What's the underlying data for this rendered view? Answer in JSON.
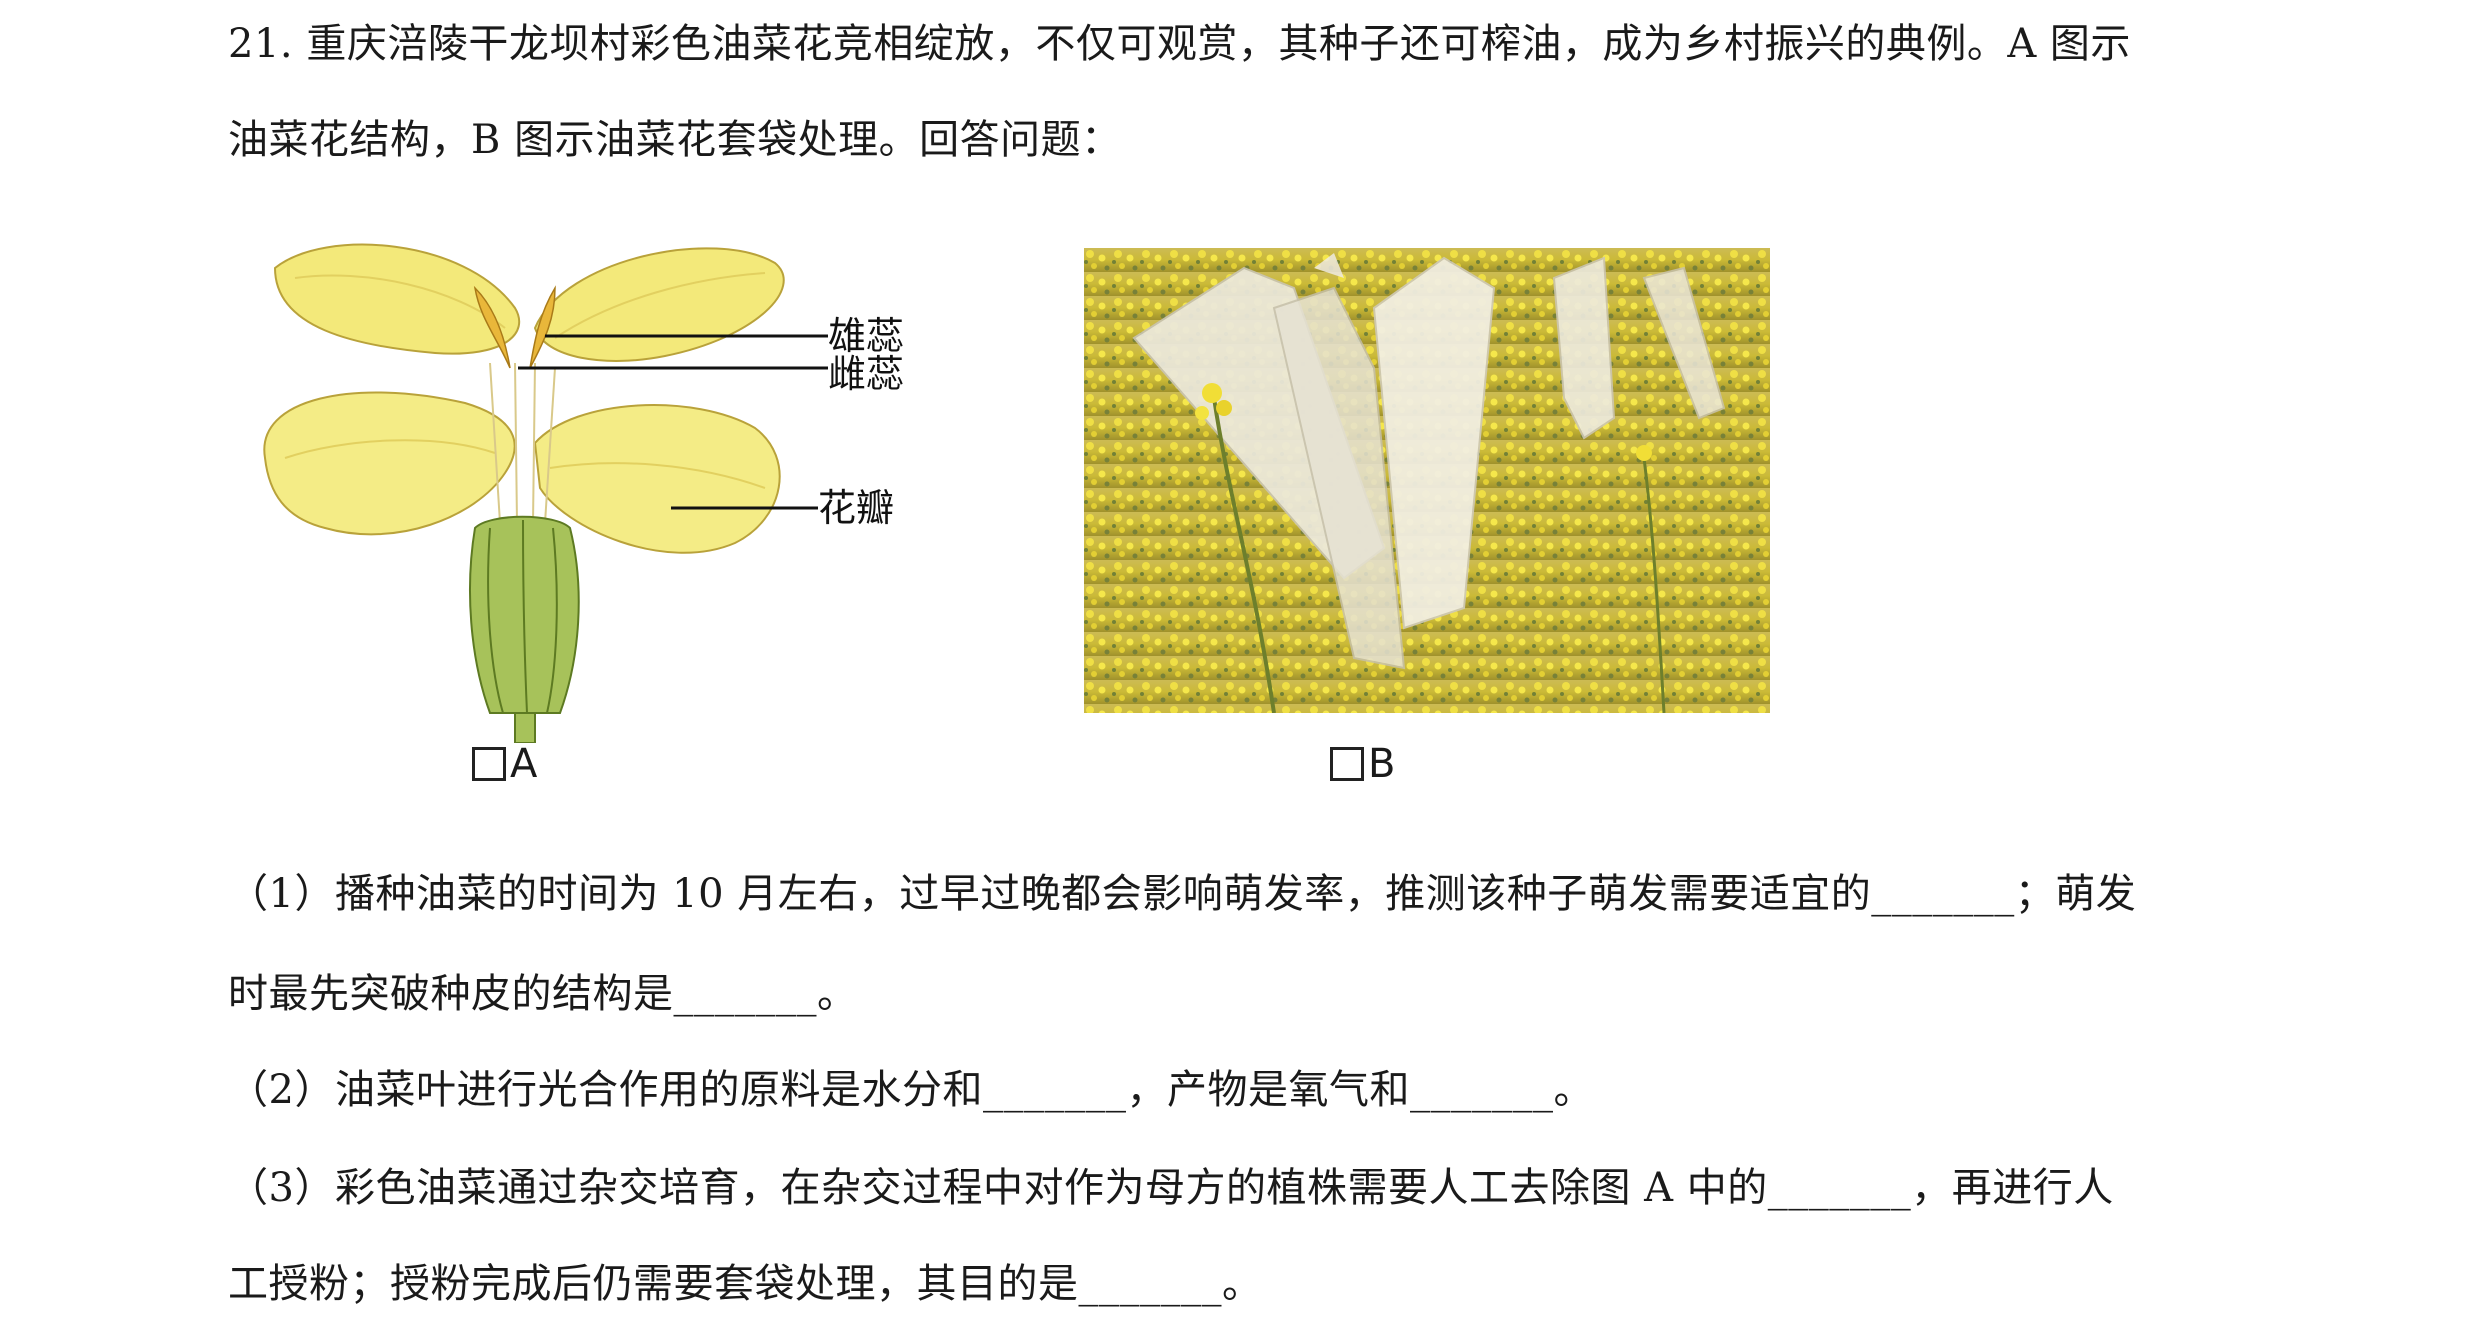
{
  "question": {
    "stem_line1": "21. 重庆涪陵干龙坝村彩色油菜花竞相绽放，不仅可观赏，其种子还可榨油，成为乡村振兴的典例。A 图示",
    "stem_line2": "油菜花结构，B 图示油菜花套袋处理。回答问题："
  },
  "figure_a": {
    "caption": "A",
    "labels": {
      "stamen": "雄蕊",
      "pistil": "雌蕊",
      "petal": "花瓣"
    }
  },
  "figure_b": {
    "caption": "B"
  },
  "parts": {
    "p1_line1": "（1）播种油菜的时间为 10 月左右，过早过晚都会影响萌发率，推测该种子萌发需要适宜的_______；萌发",
    "p1_line2": "时最先突破种皮的结构是_______。",
    "p2_line1": "（2）油菜叶进行光合作用的原料是水分和_______，产物是氧气和_______。",
    "p3_line1": "（3）彩色油菜通过杂交培育，在杂交过程中对作为母方的植株需要人工去除图 A 中的_______，再进行人",
    "p3_line2": "工授粉；授粉完成后仍需要套袋处理，其目的是_______。"
  }
}
